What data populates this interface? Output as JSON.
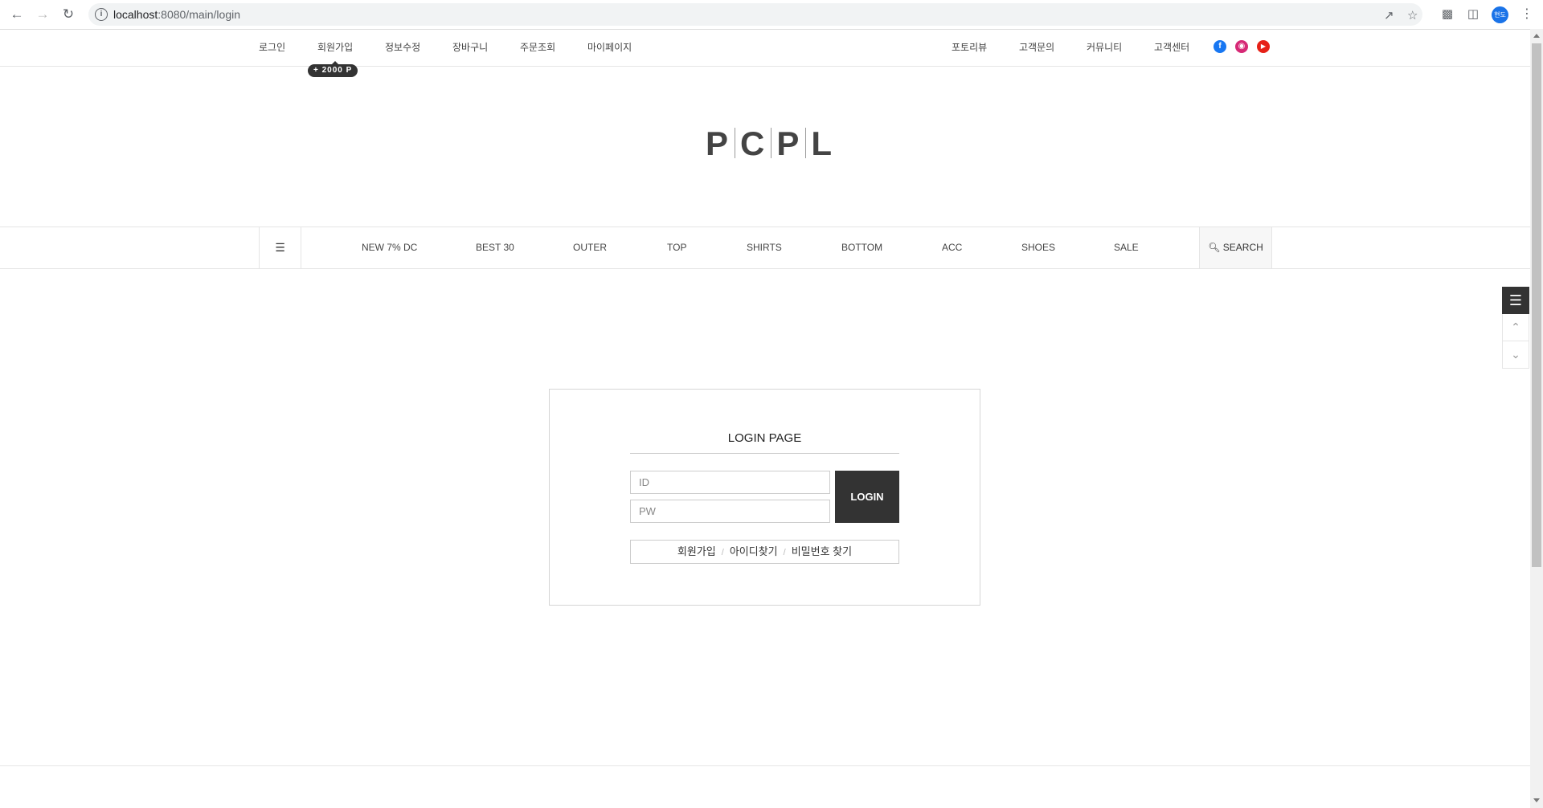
{
  "browser": {
    "url_host": "localhost",
    "url_path": ":8080/main/login",
    "profile_initials": "현도"
  },
  "util_nav": {
    "left": [
      "로그인",
      "회원가입",
      "정보수정",
      "장바구니",
      "주문조회",
      "마이페이지"
    ],
    "right": [
      "포토리뷰",
      "고객문의",
      "커뮤니티",
      "고객센터"
    ],
    "badge": "+ 2000 P",
    "social": [
      "facebook-icon",
      "instagram-icon",
      "youtube-icon"
    ]
  },
  "logo": {
    "letters": [
      "P",
      "C",
      "P",
      "L"
    ]
  },
  "category_nav": {
    "items": [
      "NEW 7% DC",
      "BEST 30",
      "OUTER",
      "TOP",
      "SHIRTS",
      "BOTTOM",
      "ACC",
      "SHOES",
      "SALE"
    ],
    "search_label": "SEARCH"
  },
  "login": {
    "title": "LOGIN PAGE",
    "id_placeholder": "ID",
    "pw_placeholder": "PW",
    "button": "LOGIN",
    "links": [
      "회원가입",
      "아이디찾기",
      "비밀번호 찾기"
    ]
  },
  "colors": {
    "dark": "#333333",
    "facebook": "#1877f2",
    "instagram": "#d62976",
    "youtube": "#e62117"
  }
}
